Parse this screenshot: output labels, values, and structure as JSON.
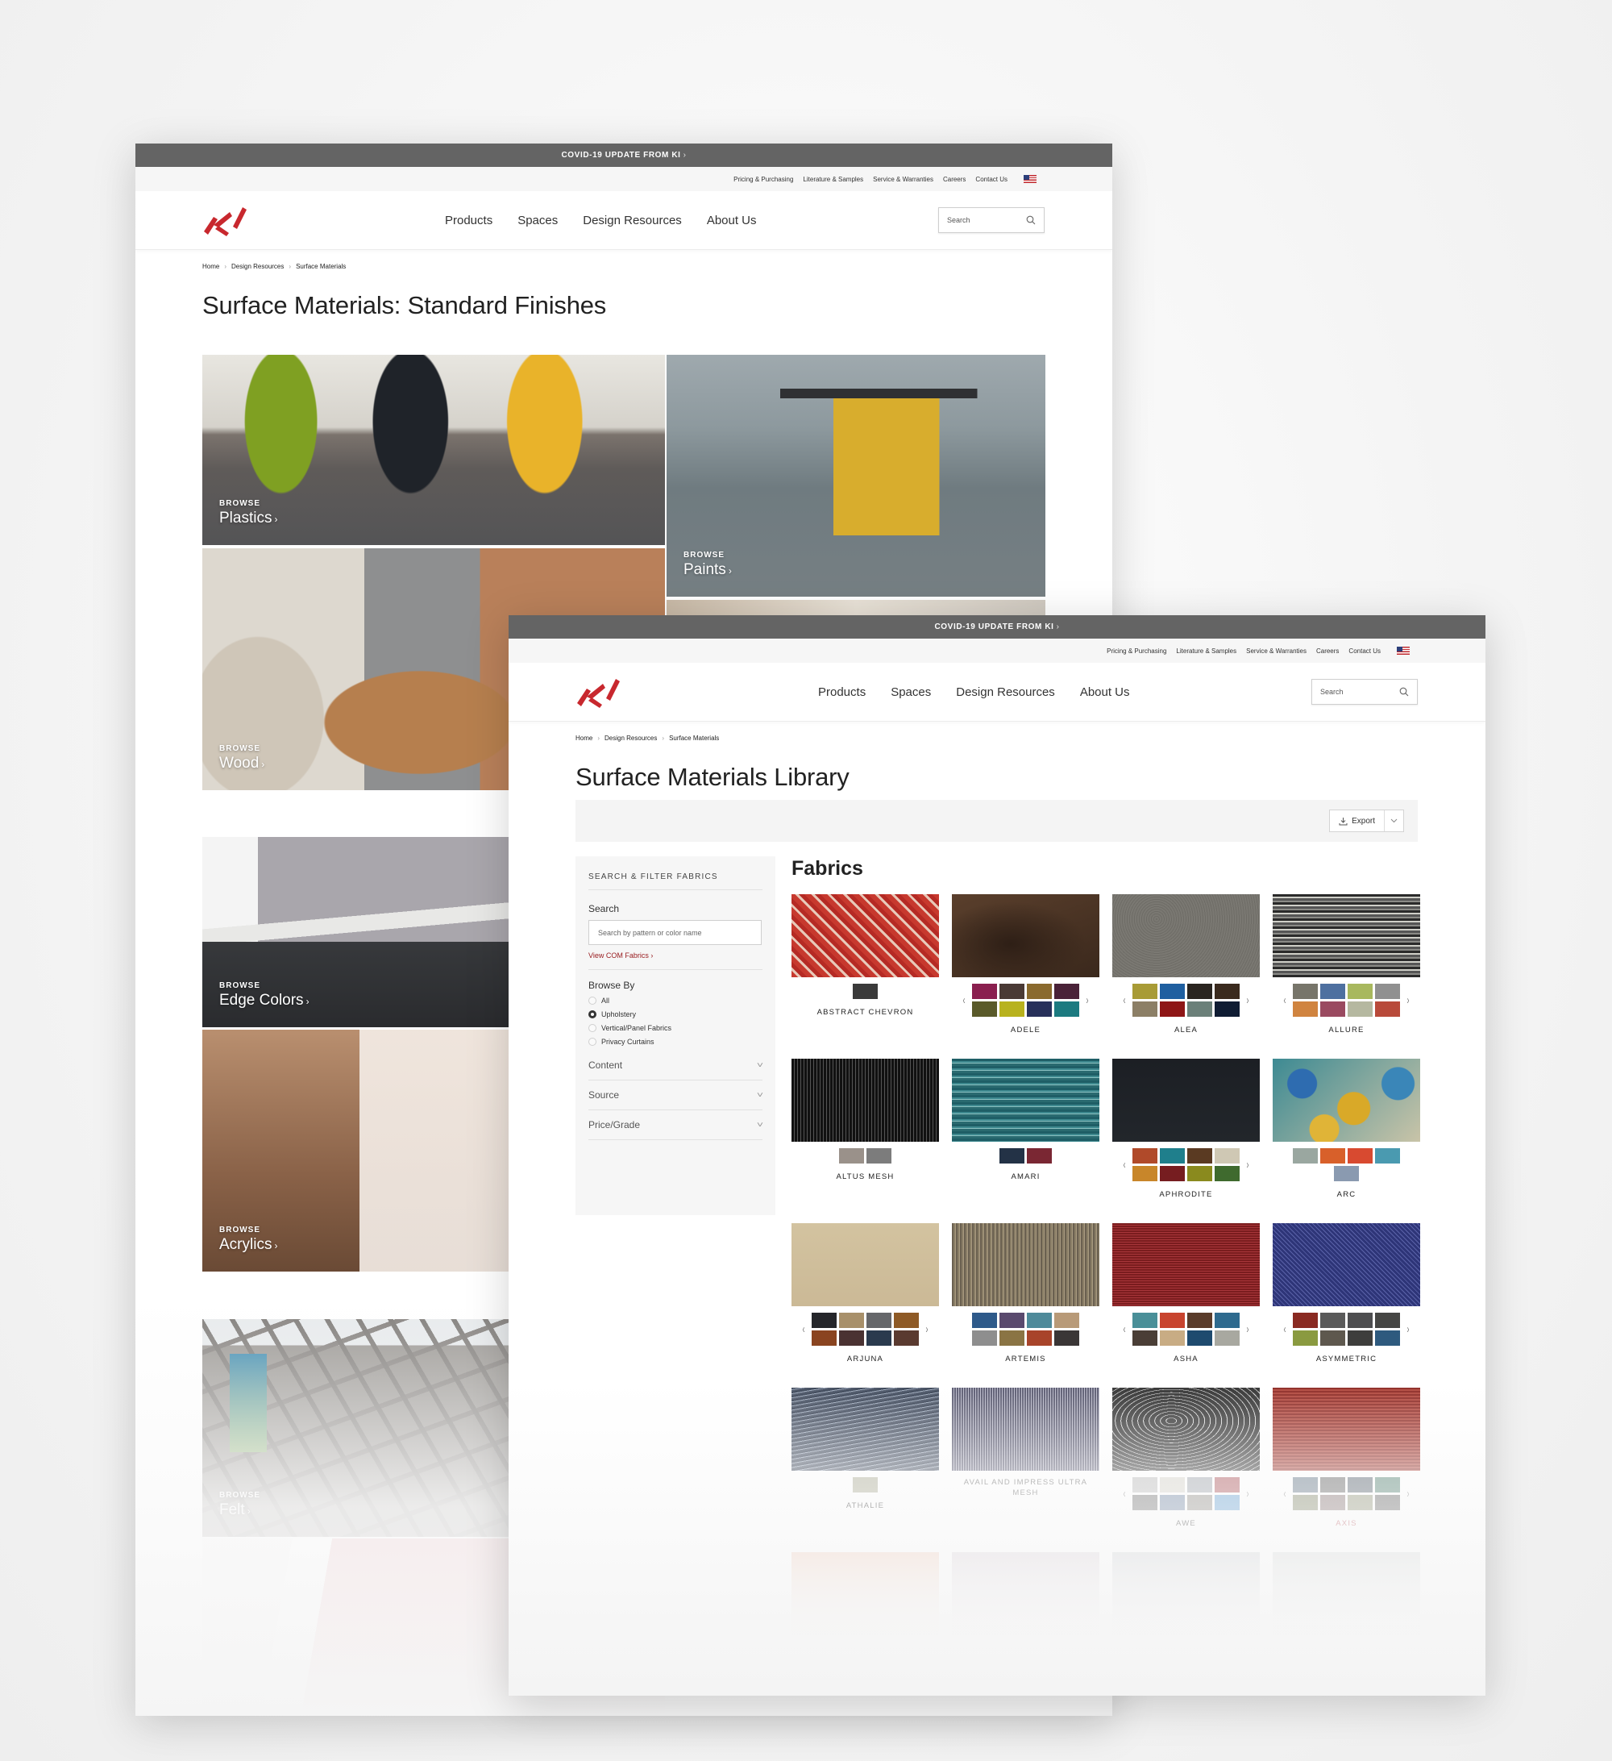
{
  "common": {
    "covid_banner": "COVID-19 UPDATE FROM KI",
    "utility_links": [
      "Pricing & Purchasing",
      "Literature & Samples",
      "Service & Warranties",
      "Careers",
      "Contact Us"
    ],
    "nav_links": [
      "Products",
      "Spaces",
      "Design Resources",
      "About Us"
    ],
    "search_placeholder": "Search",
    "breadcrumb": [
      "Home",
      "Design Resources",
      "Surface Materials"
    ],
    "brand_color": "#c8282e"
  },
  "back_page": {
    "title": "Surface Materials: Standard Finishes",
    "tiles": [
      {
        "kicker": "BROWSE",
        "label": "Plastics"
      },
      {
        "kicker": "BROWSE",
        "label": "Paints"
      },
      {
        "kicker": "BROWSE",
        "label": "Wood"
      },
      {
        "kicker": "BROWSE",
        "label": "Edge Colors"
      },
      {
        "kicker": "BROWSE",
        "label": "Acrylics"
      },
      {
        "kicker": "BROWSE",
        "label": "Felt"
      }
    ]
  },
  "front_page": {
    "title": "Surface Materials Library",
    "export_label": "Export",
    "filters": {
      "heading": "SEARCH & FILTER FABRICS",
      "search_label": "Search",
      "search_placeholder": "Search by pattern or color name",
      "com_link": "View COM Fabrics",
      "browse_by_label": "Browse By",
      "browse_options": [
        {
          "label": "All",
          "selected": false
        },
        {
          "label": "Upholstery",
          "selected": true
        },
        {
          "label": "Vertical/Panel Fabrics",
          "selected": false
        },
        {
          "label": "Privacy Curtains",
          "selected": false
        }
      ],
      "accordions": [
        "Content",
        "Source",
        "Price/Grade"
      ]
    },
    "section_title": "Fabrics",
    "fabrics": [
      {
        "name": "ABSTRACT CHEVRON",
        "carousel": false,
        "swatches": [
          "#3a3a3a"
        ]
      },
      {
        "name": "ADELE",
        "carousel": true,
        "swatches": [
          "#8a1f4f",
          "#4a3a35",
          "#8a6a2e",
          "#4a2238",
          "#5a5a2a",
          "#b8b21e",
          "#27305a",
          "#1c7a80"
        ]
      },
      {
        "name": "ALEA",
        "carousel": true,
        "swatches": [
          "#a89b36",
          "#1f5fa0",
          "#2a2520",
          "#3a2a1e",
          "#8c7f66",
          "#8e1616",
          "#6b8079",
          "#0f1c33"
        ]
      },
      {
        "name": "ALLURE",
        "carousel": true,
        "swatches": [
          "#77756a",
          "#4e70a0",
          "#a8b85e",
          "#909090",
          "#d08440",
          "#9a4a60",
          "#b5b8a0",
          "#b84a3a"
        ]
      },
      {
        "name": "ALTUS MESH",
        "carousel": false,
        "swatches": [
          "#9a918a",
          "#7c7c7c"
        ]
      },
      {
        "name": "AMARI",
        "carousel": false,
        "swatches": [
          "#233246",
          "#7a2733"
        ]
      },
      {
        "name": "APHRODITE",
        "carousel": true,
        "swatches": [
          "#b04a2a",
          "#1f7f8c",
          "#5a3a22",
          "#cfc8b4",
          "#c8862a",
          "#761d20",
          "#8a8a1e",
          "#3f6a2e"
        ]
      },
      {
        "name": "ARC",
        "carousel": false,
        "swatches": [
          "#9aa7a0",
          "#d8602a",
          "#d84a30",
          "#4a9ab0",
          "#8a9ab0"
        ]
      },
      {
        "name": "ARJUNA",
        "carousel": true,
        "swatches": [
          "#25262a",
          "#a8906a",
          "#66676a",
          "#8e5a26",
          "#8a4420",
          "#4a3232",
          "#2a3a4e",
          "#5a3a30"
        ]
      },
      {
        "name": "ARTEMIS",
        "carousel": false,
        "swatches": [
          "#2e5a8a",
          "#5a4a6e",
          "#4e8a9a",
          "#b89a78",
          "#8e8e8e",
          "#8a7444",
          "#a8442a",
          "#3a3636"
        ]
      },
      {
        "name": "ASHA",
        "carousel": true,
        "swatches": [
          "#4a8f98",
          "#c8442e",
          "#5a3c2a",
          "#2e6a8e",
          "#4a3e36",
          "#c8ac84",
          "#1e4a6e",
          "#a8a8a0"
        ]
      },
      {
        "name": "ASYMMETRIC",
        "carousel": true,
        "swatches": [
          "#8a2a22",
          "#5a5a5a",
          "#4e4e50",
          "#464644",
          "#8a9a40",
          "#5e584e",
          "#3e3e3c",
          "#2e5a7e"
        ]
      },
      {
        "name": "ATHALIE",
        "carousel": false,
        "swatches": [
          "#a8a890"
        ]
      },
      {
        "name": "AVAIL AND IMPRESS ULTRA MESH",
        "carousel": false,
        "swatches": []
      },
      {
        "name": "AWE",
        "carousel": true,
        "swatches": [
          "#b8b8b8",
          "#d4d2c8",
          "#9aa0a8",
          "#a84a50",
          "#6a6a6a",
          "#6a80a0",
          "#8a8680",
          "#5a9ad0"
        ]
      },
      {
        "name": "AXIS",
        "carousel": true,
        "highlighted": true,
        "swatches": [
          "#5a6e80",
          "#5a5a5a",
          "#4e5a66",
          "#4a7a6a",
          "#7a8060",
          "#7e6a6a",
          "#8a8e70",
          "#5a5a5a"
        ]
      }
    ],
    "faded_row_tints": [
      "#f0c0a8",
      "#d4c8d0",
      "#c4c8cc",
      "#cfd3d2"
    ]
  }
}
